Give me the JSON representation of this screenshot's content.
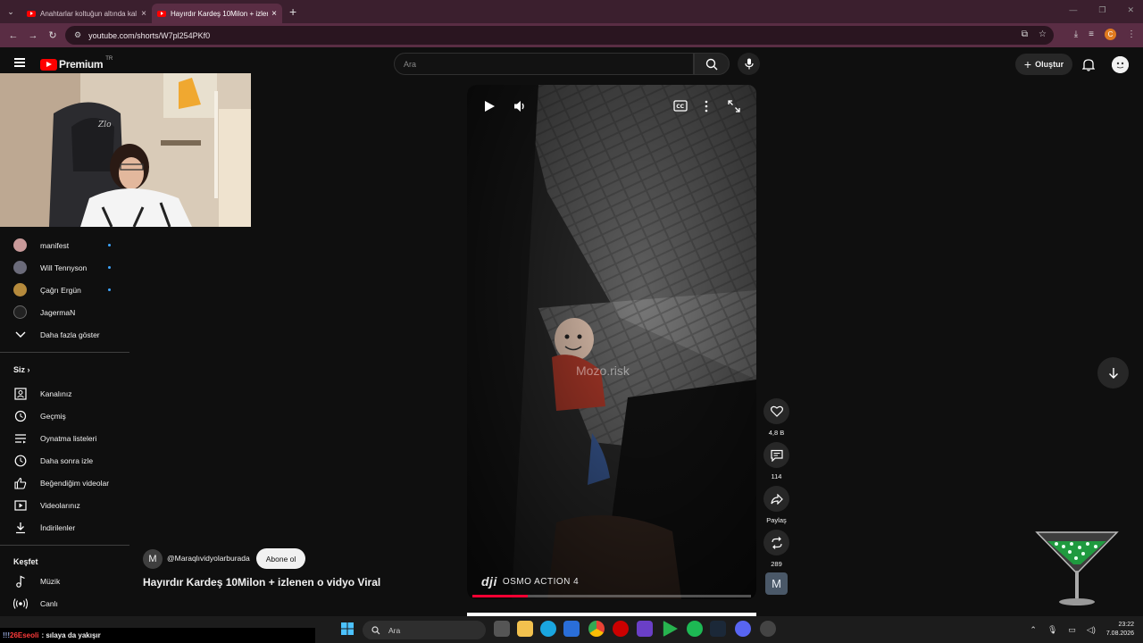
{
  "browser": {
    "tabs": [
      {
        "title": "Anahtarlar koltuğun altında kal",
        "active": false
      },
      {
        "title": "Hayırdır Kardeş 10Milon + izlen",
        "active": true
      }
    ],
    "url": "youtube.com/shorts/W7pl254PKf0",
    "profile_initial": "C"
  },
  "youtube": {
    "logo_text": "Premium",
    "logo_region": "TR",
    "search_placeholder": "Ara",
    "create_label": "Oluştur"
  },
  "sidebar": {
    "subscriptions": [
      {
        "name": "manifest",
        "new": true,
        "color": "#c99a9a"
      },
      {
        "name": "Will Tennyson",
        "new": true,
        "color": "#6b6b7a"
      },
      {
        "name": "Çağrı Ergün",
        "new": true,
        "color": "#b58a3c"
      },
      {
        "name": "JagermaN",
        "new": false,
        "color": "#444"
      }
    ],
    "show_more": "Daha fazla göster",
    "you_heading": "Siz",
    "you_items": [
      {
        "label": "Kanalınız",
        "icon": "channel-icon"
      },
      {
        "label": "Geçmiş",
        "icon": "history-icon"
      },
      {
        "label": "Oynatma listeleri",
        "icon": "playlists-icon"
      },
      {
        "label": "Daha sonra izle",
        "icon": "watch-later-icon"
      },
      {
        "label": "Beğendiğim videolar",
        "icon": "like-icon"
      },
      {
        "label": "Videolarınız",
        "icon": "your-videos-icon"
      },
      {
        "label": "İndirilenler",
        "icon": "downloads-icon"
      }
    ],
    "explore_heading": "Keşfet",
    "explore_items": [
      {
        "label": "Müzik",
        "icon": "music-icon"
      },
      {
        "label": "Canlı",
        "icon": "live-icon"
      }
    ]
  },
  "short": {
    "watermark": "Mozo.risk",
    "camera_brand": "OSMO ACTION 4",
    "camera_logo": "dji",
    "progress": 0.2,
    "channel_initial": "M",
    "channel_handle": "@Maraqlıvidyolarburada",
    "subscribe_label": "Abone ol",
    "title": "Hayırdır Kardeş  10Milon + izlenen o vidyo Viral",
    "likes": "4,8 B",
    "comments": "114",
    "share_label": "Paylaş",
    "remix": "289",
    "audio_initial": "M"
  },
  "overlay": {
    "ticker_user": "26Eseoli",
    "ticker_text": ": sılaya da yakışır"
  },
  "taskbar": {
    "search_label": "Ara",
    "time": "23:22",
    "date": "7.08.2026"
  }
}
